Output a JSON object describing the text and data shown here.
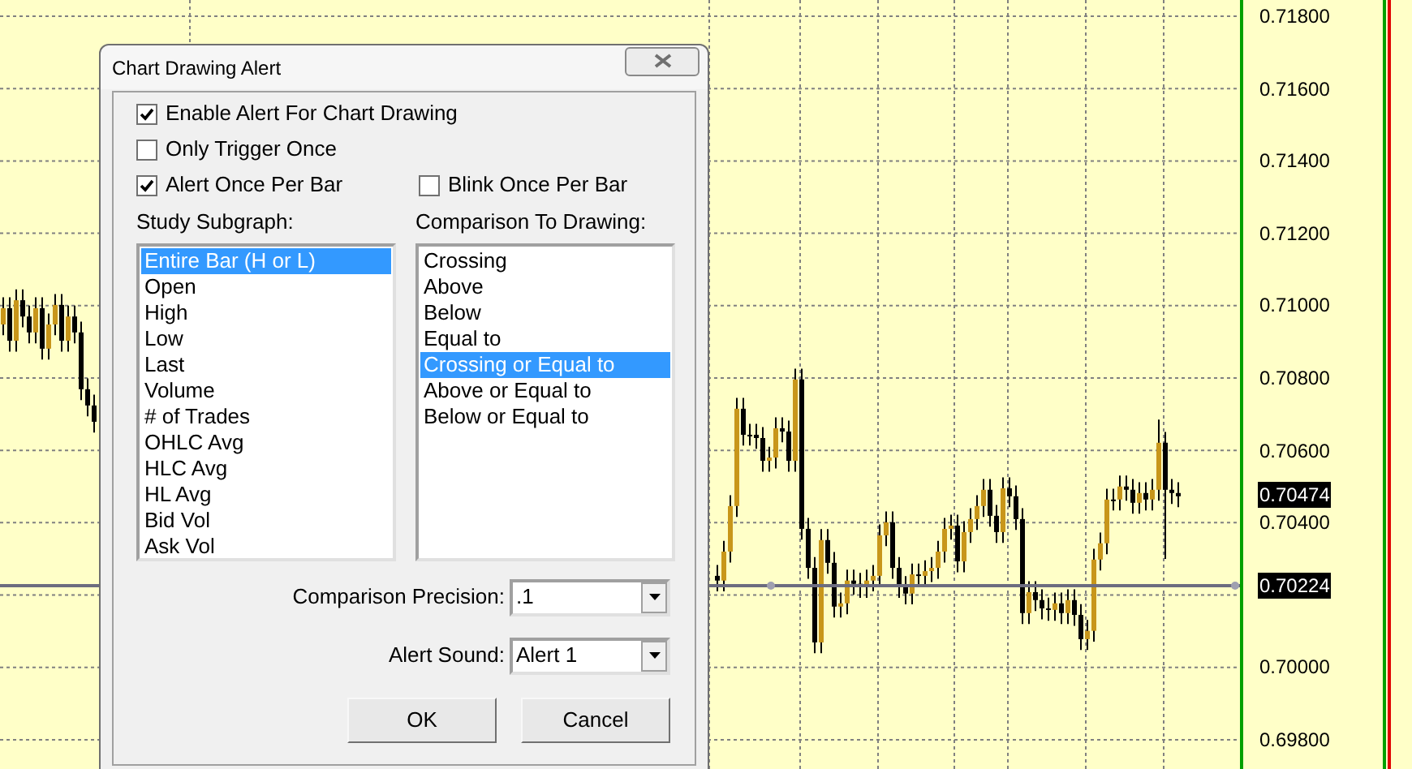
{
  "dialog": {
    "title": "Chart Drawing Alert",
    "checkboxes": [
      {
        "label": "Enable Alert For Chart Drawing",
        "checked": true
      },
      {
        "label": "Only Trigger Once",
        "checked": false
      },
      {
        "label": "Alert Once Per Bar",
        "checked": true
      },
      {
        "label": "Blink Once Per Bar",
        "checked": false
      }
    ],
    "study_subgraph": {
      "label": "Study Subgraph:",
      "items": [
        {
          "label": "Entire Bar (H or L)",
          "selected": true
        },
        {
          "label": "Open",
          "selected": false
        },
        {
          "label": "High",
          "selected": false
        },
        {
          "label": "Low",
          "selected": false
        },
        {
          "label": "Last",
          "selected": false
        },
        {
          "label": "Volume",
          "selected": false
        },
        {
          "label": "# of Trades",
          "selected": false
        },
        {
          "label": "OHLC Avg",
          "selected": false
        },
        {
          "label": "HLC Avg",
          "selected": false
        },
        {
          "label": "HL Avg",
          "selected": false
        },
        {
          "label": "Bid Vol",
          "selected": false
        },
        {
          "label": "Ask Vol",
          "selected": false
        }
      ]
    },
    "comparison": {
      "label": "Comparison To Drawing:",
      "items": [
        {
          "label": "Crossing",
          "selected": false
        },
        {
          "label": "Above",
          "selected": false
        },
        {
          "label": "Below",
          "selected": false
        },
        {
          "label": "Equal to",
          "selected": false
        },
        {
          "label": "Crossing or Equal to",
          "selected": true
        },
        {
          "label": "Above or Equal to",
          "selected": false
        },
        {
          "label": "Below or Equal to",
          "selected": false
        }
      ]
    },
    "precision": {
      "label": "Comparison Precision:",
      "value": ".1"
    },
    "sound": {
      "label": "Alert Sound:",
      "value": "Alert 1"
    },
    "buttons": [
      "OK",
      "Cancel"
    ]
  },
  "chart": {
    "chart_data": {
      "type": "candlestick",
      "ylim": [
        0.69719,
        0.71845
      ],
      "grid": true,
      "yticks": [
        {
          "value": 0.718,
          "label": "0.71800"
        },
        {
          "value": 0.716,
          "label": "0.71600"
        },
        {
          "value": 0.714,
          "label": "0.71400"
        },
        {
          "value": 0.712,
          "label": "0.71200"
        },
        {
          "value": 0.71,
          "label": "0.71000"
        },
        {
          "value": 0.708,
          "label": "0.70800"
        },
        {
          "value": 0.706,
          "label": "0.70600"
        },
        {
          "value": 0.704,
          "label": "0.70400"
        },
        {
          "value": 0.7,
          "label": "0.70000"
        },
        {
          "value": 0.698,
          "label": "0.69800"
        }
      ],
      "categories": [
        null,
        null,
        null,
        null,
        null,
        null,
        null,
        null,
        null,
        null,
        null,
        null,
        null,
        null,
        null,
        null,
        null,
        null,
        null,
        null,
        null,
        null,
        null,
        null,
        null,
        null,
        null,
        null,
        null,
        null,
        null,
        null,
        null,
        null,
        null,
        null,
        null,
        null,
        null,
        null,
        null,
        null,
        null,
        null,
        null,
        null,
        null,
        null,
        null,
        null,
        null,
        null,
        null,
        null,
        null,
        null,
        null,
        null,
        null,
        null,
        null,
        null,
        null,
        null,
        null,
        null,
        null,
        null,
        null,
        null,
        null,
        null,
        null,
        null,
        null,
        null,
        null,
        null,
        null,
        null,
        null,
        null,
        null,
        null,
        null,
        null,
        null,
        null,
        null,
        null,
        null,
        null,
        null,
        null,
        null,
        null,
        null,
        null,
        null,
        null,
        null,
        null,
        null,
        null,
        null,
        null,
        null,
        null,
        null,
        null,
        null,
        null,
        null,
        null,
        null,
        null,
        null,
        null,
        null,
        null,
        null,
        null,
        null,
        null,
        null,
        null,
        null,
        null,
        null,
        null,
        null,
        null,
        null,
        null,
        null,
        null,
        null,
        null,
        null,
        null,
        null,
        null,
        null,
        null,
        null,
        null,
        null,
        null,
        null,
        null,
        null,
        null,
        null,
        null,
        null,
        null,
        null,
        null,
        null,
        null,
        null,
        null,
        null,
        null,
        null,
        null,
        null,
        null,
        null,
        null,
        null,
        null,
        null,
        null,
        null,
        null,
        null,
        null,
        null,
        null,
        null,
        null
      ],
      "ohlc": [
        [
          0.70948,
          0.71023,
          0.70918,
          0.70993
        ],
        [
          0.70993,
          0.71023,
          0.70873,
          0.70903
        ],
        [
          0.70903,
          0.71045,
          0.70873,
          0.71015
        ],
        [
          0.71015,
          0.71045,
          0.7094,
          0.7097
        ],
        [
          0.7097,
          0.71,
          0.70896,
          0.70926
        ],
        [
          0.70926,
          0.71023,
          0.70896,
          0.70993
        ],
        [
          0.70993,
          0.71023,
          0.70851,
          0.70881
        ],
        [
          0.70881,
          0.70978,
          0.70851,
          0.70948
        ],
        [
          0.70948,
          0.71032,
          0.70918,
          0.71002
        ],
        [
          0.71002,
          0.71032,
          0.70873,
          0.70903
        ],
        [
          0.70903,
          0.71,
          0.70873,
          0.7097
        ],
        [
          0.7097,
          0.71,
          0.70896,
          0.70926
        ],
        [
          0.70926,
          0.70956,
          0.70739,
          0.70769
        ],
        [
          0.70769,
          0.70799,
          0.70694,
          0.70724
        ],
        [
          0.70724,
          0.70754,
          0.70649,
          0.70679
        ],
        null,
        null,
        null,
        null,
        null,
        null,
        null,
        null,
        null,
        null,
        null,
        null,
        null,
        null,
        null,
        null,
        null,
        null,
        null,
        null,
        null,
        null,
        null,
        null,
        null,
        null,
        null,
        null,
        null,
        null,
        null,
        null,
        null,
        null,
        null,
        null,
        null,
        null,
        null,
        null,
        null,
        null,
        null,
        null,
        null,
        null,
        null,
        null,
        null,
        null,
        null,
        null,
        null,
        null,
        null,
        null,
        null,
        null,
        null,
        null,
        null,
        null,
        null,
        null,
        null,
        null,
        null,
        null,
        null,
        null,
        null,
        null,
        null,
        null,
        null,
        null,
        null,
        null,
        null,
        null,
        null,
        null,
        null,
        null,
        null,
        null,
        null,
        null,
        null,
        null,
        null,
        null,
        null,
        null,
        null,
        [
          0.70253,
          0.70283,
          0.7021,
          0.7024
        ],
        [
          0.7024,
          0.7035,
          0.7021,
          0.7032
        ],
        [
          0.7032,
          0.70476,
          0.7029,
          0.70446
        ],
        [
          0.70446,
          0.70745,
          0.70416,
          0.70715
        ],
        [
          0.70715,
          0.70745,
          0.70613,
          0.70643
        ],
        [
          0.70643,
          0.70673,
          0.70613,
          0.70643
        ],
        [
          0.70643,
          0.70673,
          0.70604,
          0.70634
        ],
        [
          0.70634,
          0.70664,
          0.70541,
          0.70571
        ],
        [
          0.70571,
          0.7061,
          0.70541,
          0.7058
        ],
        [
          0.7058,
          0.70691,
          0.7055,
          0.70661
        ],
        [
          0.70661,
          0.70691,
          0.70622,
          0.70652
        ],
        [
          0.70652,
          0.70682,
          0.70541,
          0.70571
        ],
        [
          0.70571,
          0.70826,
          0.70541,
          0.70796
        ],
        [
          0.70796,
          0.70826,
          0.70353,
          0.70383
        ],
        [
          0.70383,
          0.70413,
          0.70245,
          0.70275
        ],
        [
          0.70275,
          0.70305,
          0.70039,
          0.70069
        ],
        [
          0.70069,
          0.70382,
          0.70039,
          0.70352
        ],
        [
          0.70352,
          0.70382,
          0.70259,
          0.70289
        ],
        [
          0.70289,
          0.70319,
          0.70138,
          0.70168
        ],
        [
          0.70168,
          0.70207,
          0.70138,
          0.70177
        ],
        [
          0.70177,
          0.7027,
          0.70147,
          0.7024
        ],
        [
          0.7024,
          0.7027,
          0.70201,
          0.70231
        ],
        [
          0.70231,
          0.70261,
          0.70192,
          0.70222
        ],
        [
          0.70222,
          0.7027,
          0.70192,
          0.7024
        ],
        [
          0.7024,
          0.70283,
          0.7021,
          0.70253
        ],
        [
          0.70253,
          0.70395,
          0.70223,
          0.70365
        ],
        [
          0.70365,
          0.70431,
          0.70335,
          0.70401
        ],
        [
          0.70401,
          0.70431,
          0.70245,
          0.70275
        ],
        [
          0.70275,
          0.70305,
          0.70192,
          0.70222
        ],
        [
          0.70222,
          0.70252,
          0.70174,
          0.70204
        ],
        [
          0.70204,
          0.70287,
          0.70174,
          0.70257
        ],
        [
          0.70257,
          0.70287,
          0.70223,
          0.70253
        ],
        [
          0.70253,
          0.70296,
          0.70223,
          0.70266
        ],
        [
          0.70266,
          0.70305,
          0.70236,
          0.70275
        ],
        [
          0.70275,
          0.7035,
          0.70245,
          0.7032
        ],
        [
          0.7032,
          0.70413,
          0.7029,
          0.70383
        ],
        [
          0.70383,
          0.70422,
          0.70353,
          0.70392
        ],
        [
          0.70392,
          0.70422,
          0.70263,
          0.70293
        ],
        [
          0.70293,
          0.70404,
          0.70263,
          0.70374
        ],
        [
          0.70374,
          0.7044,
          0.70344,
          0.7041
        ],
        [
          0.7041,
          0.70476,
          0.7038,
          0.70446
        ],
        [
          0.70446,
          0.70521,
          0.70416,
          0.70491
        ],
        [
          0.70491,
          0.70521,
          0.70389,
          0.70419
        ],
        [
          0.70419,
          0.70449,
          0.70344,
          0.70374
        ],
        [
          0.70374,
          0.70525,
          0.70344,
          0.70495
        ],
        [
          0.70495,
          0.70525,
          0.70443,
          0.70473
        ],
        [
          0.70473,
          0.70503,
          0.7038,
          0.7041
        ],
        [
          0.7041,
          0.7044,
          0.7012,
          0.7015
        ],
        [
          0.7015,
          0.70238,
          0.7012,
          0.70208
        ],
        [
          0.70208,
          0.70238,
          0.70156,
          0.70186
        ],
        [
          0.70186,
          0.70216,
          0.70133,
          0.70163
        ],
        [
          0.70163,
          0.70193,
          0.70129,
          0.70159
        ],
        [
          0.70159,
          0.70207,
          0.70129,
          0.70177
        ],
        [
          0.70177,
          0.70207,
          0.7012,
          0.7015
        ],
        [
          0.7015,
          0.70216,
          0.7012,
          0.70186
        ],
        [
          0.70186,
          0.70216,
          0.70115,
          0.70145
        ],
        [
          0.70145,
          0.70175,
          0.70048,
          0.70078
        ],
        [
          0.70078,
          0.70131,
          0.70048,
          0.70101
        ],
        [
          0.70101,
          0.70328,
          0.70071,
          0.70298
        ],
        [
          0.70298,
          0.70373,
          0.70268,
          0.70343
        ],
        [
          0.70343,
          0.70494,
          0.70313,
          0.70464
        ],
        [
          0.70464,
          0.70494,
          0.70434,
          0.70464
        ],
        [
          0.70464,
          0.7053,
          0.70434,
          0.705
        ],
        [
          0.705,
          0.7053,
          0.70461,
          0.70491
        ],
        [
          0.70491,
          0.70521,
          0.70425,
          0.70455
        ],
        [
          0.70455,
          0.70512,
          0.70425,
          0.70482
        ],
        [
          0.70482,
          0.70512,
          0.70434,
          0.70464
        ],
        [
          0.70464,
          0.70521,
          0.70434,
          0.70491
        ],
        [
          0.70491,
          0.70685,
          0.70461,
          0.70621
        ],
        [
          0.70621,
          0.70651,
          0.703,
          0.70491
        ],
        [
          0.70491,
          0.70521,
          0.70452,
          0.70482
        ],
        [
          0.70482,
          0.70512,
          0.70443,
          0.70473
        ]
      ],
      "annotations": [
        "0.70474",
        "0.70224"
      ]
    }
  }
}
